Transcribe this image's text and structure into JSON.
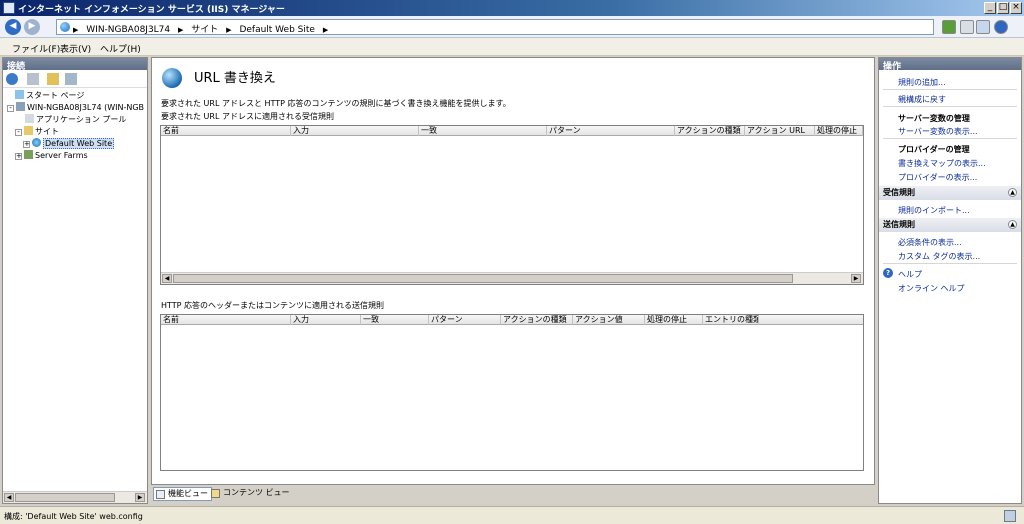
{
  "window": {
    "title": "インターネット インフォメーション サービス (IIS) マネージャー",
    "buttons": {
      "minimize": "_",
      "maximize": "□",
      "close": "×"
    }
  },
  "address": {
    "breadcrumbs": [
      "WIN-NGBA08J3L74",
      "サイト",
      "Default Web Site"
    ],
    "back_icon": "back-arrow-icon",
    "forward_icon": "forward-arrow-icon"
  },
  "menu": {
    "items": [
      "ファイル(F)",
      "表示(V)",
      "ヘルプ(H)"
    ]
  },
  "connections": {
    "header": "接続",
    "tree": [
      {
        "label": "スタート ページ",
        "icon": "start-page-icon"
      },
      {
        "label": "WIN-NGBA08J3L74 (WIN-NGB",
        "icon": "server-icon",
        "expander": "-"
      },
      {
        "label": "アプリケーション プール",
        "icon": "app-pool-icon"
      },
      {
        "label": "サイト",
        "icon": "sites-folder-icon",
        "expander": "-"
      },
      {
        "label": "Default Web Site",
        "icon": "website-globe-icon",
        "expander": "+"
      },
      {
        "label": "Server Farms",
        "icon": "server-farm-icon",
        "expander": "+"
      }
    ]
  },
  "feature": {
    "title": "URL 書き換え",
    "description": "要求された URL アドレスと HTTP 応答のコンテンツの規則に基づく書き換え機能を提供します。",
    "inbound_caption": "要求された URL アドレスに適用される受信規則",
    "inbound_columns": [
      "名前",
      "入力",
      "一致",
      "パターン",
      "アクションの種類",
      "アクション URL",
      "処理の停止"
    ],
    "outbound_caption": "HTTP 応答のヘッダーまたはコンテンツに適用される送信規則",
    "outbound_columns": [
      "名前",
      "入力",
      "一致",
      "パターン",
      "アクションの種類",
      "アクション値",
      "処理の停止",
      "エントリの種類"
    ]
  },
  "view_tabs": [
    "機能ビュー",
    "コンテンツ ビュー"
  ],
  "actions": {
    "header": "操作",
    "add_rule": "規則の追加...",
    "revert_parent": "親構成に戻す",
    "server_vars_head": "サーバー変数の管理",
    "server_vars_view": "サーバー変数の表示...",
    "provider_head": "プロバイダーの管理",
    "rewrite_maps": "書き換えマップの表示...",
    "providers_view": "プロバイダーの表示...",
    "inbound_head": "受信規則",
    "import_rules": "規則のインポート...",
    "outbound_head": "送信規則",
    "preconditions": "必須条件の表示...",
    "custom_tags": "カスタム タグの表示...",
    "help": "ヘルプ",
    "online_help": "オンライン ヘルプ"
  },
  "status": {
    "text": "構成: 'Default Web Site' web.config"
  },
  "colors": {
    "title_bar": "#0a246a",
    "link": "#0b2b9c",
    "panel_header": "#5f6f88"
  }
}
